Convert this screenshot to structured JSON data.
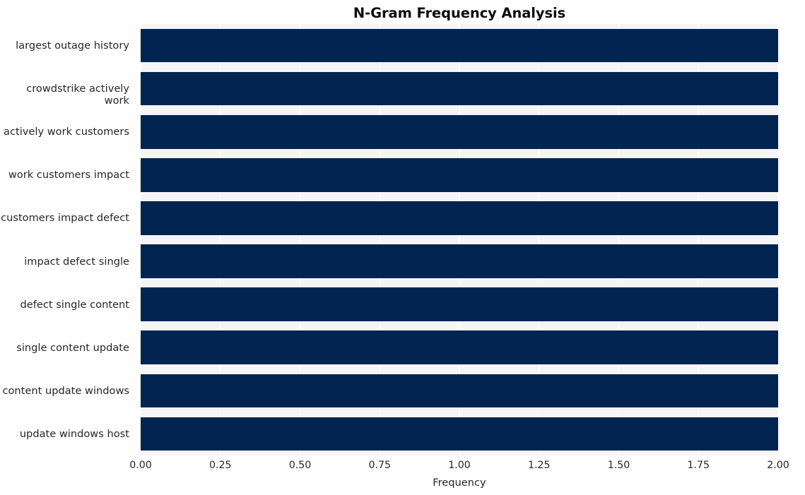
{
  "chart_data": {
    "type": "bar",
    "orientation": "horizontal",
    "title": "N-Gram Frequency Analysis",
    "xlabel": "Frequency",
    "ylabel": "",
    "categories": [
      "largest outage history",
      "crowdstrike actively work",
      "actively work customers",
      "work customers impact",
      "customers impact defect",
      "impact defect single",
      "defect single content",
      "single content update",
      "content update windows",
      "update windows host"
    ],
    "values": [
      2.0,
      2.0,
      2.0,
      2.0,
      2.0,
      2.0,
      2.0,
      2.0,
      2.0,
      2.0
    ],
    "xlim": [
      0.0,
      2.0
    ],
    "xticks": [
      "0.00",
      "0.25",
      "0.50",
      "0.75",
      "1.00",
      "1.25",
      "1.50",
      "1.75",
      "2.00"
    ],
    "xtick_values": [
      0.0,
      0.25,
      0.5,
      0.75,
      1.0,
      1.25,
      1.5,
      1.75,
      2.0
    ],
    "grid": true,
    "grid_axis": "x",
    "legend": false,
    "bar_color": "#022450",
    "plot_background": "#f5f5f6",
    "figure_background": "#ffffff",
    "grid_color": "#ffffff",
    "text_color": "#262626",
    "title_color": "#0d0d0d"
  }
}
